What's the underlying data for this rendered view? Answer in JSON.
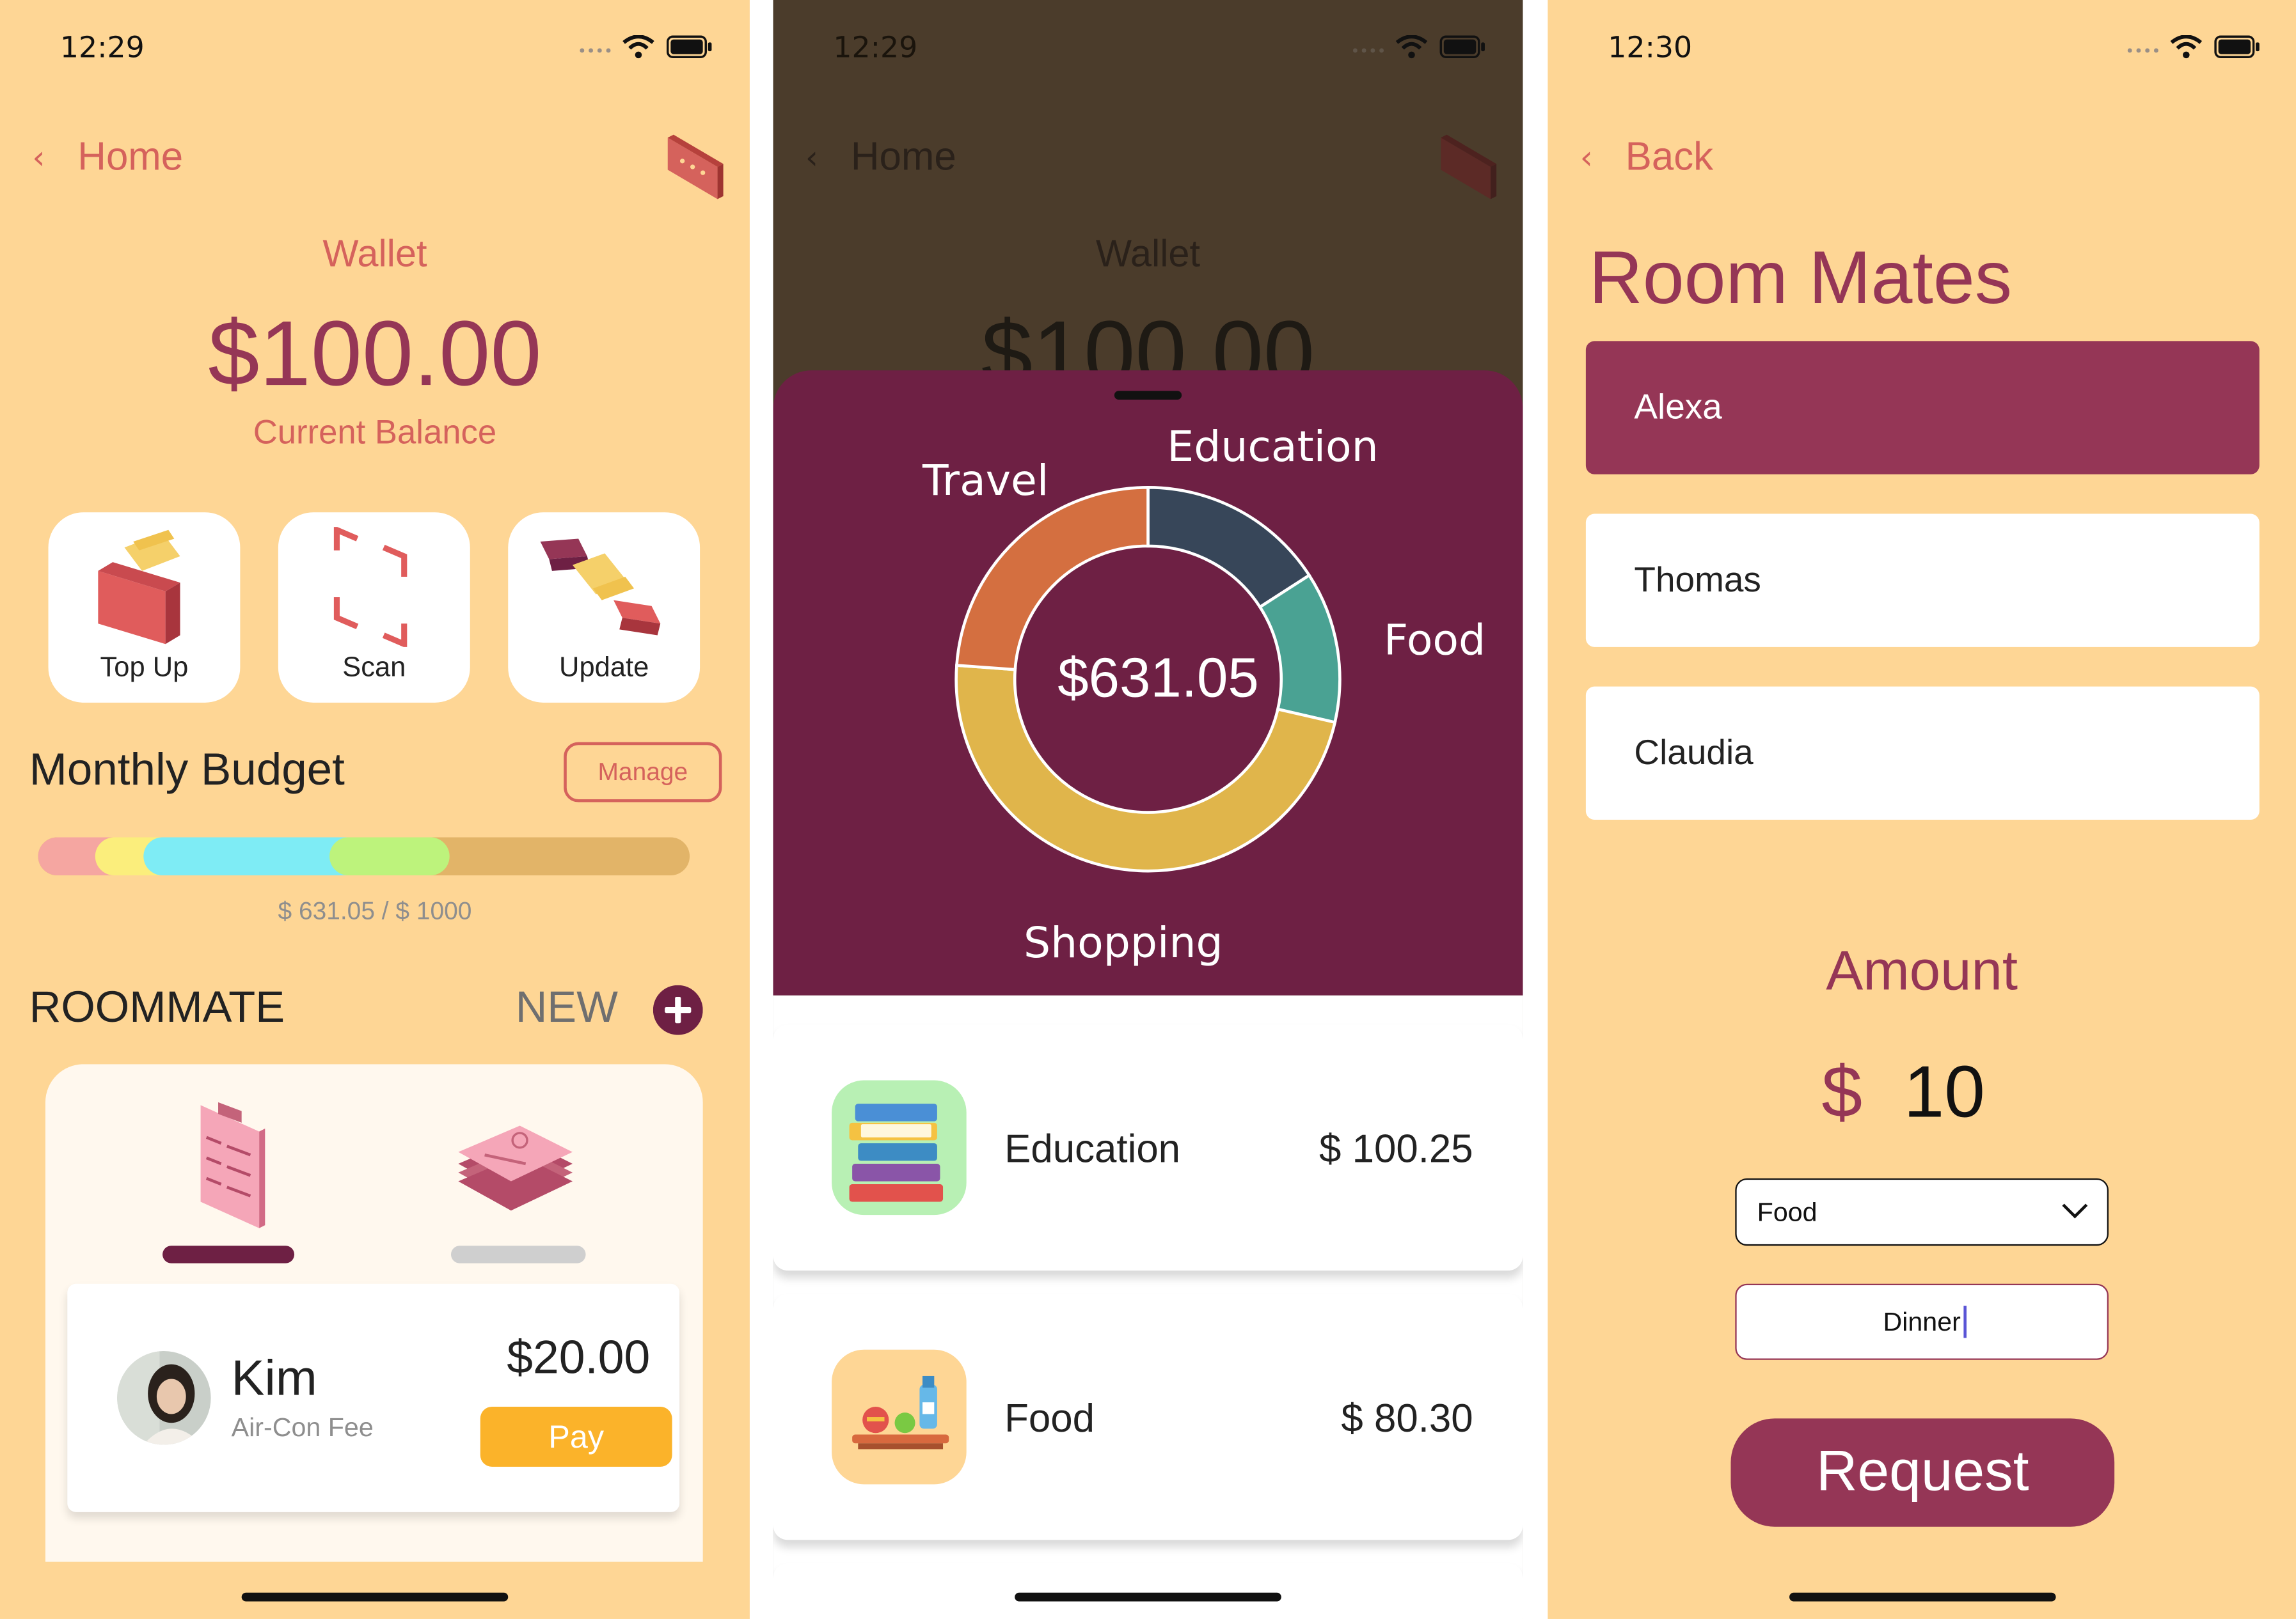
{
  "colors": {
    "background": "#fed695",
    "accent": "#d5625c",
    "plum": "#6e2044",
    "wine": "#953656",
    "pay": "#fbb32a"
  },
  "wallet_screen": {
    "time": "12:29",
    "back_label": "Home",
    "title": "Wallet",
    "balance": "$100.00",
    "balance_caption": "Current Balance",
    "actions": [
      {
        "label": "Top Up",
        "icon": "wallet-icon"
      },
      {
        "label": "Scan",
        "icon": "scan-frame-icon"
      },
      {
        "label": "Update",
        "icon": "transfer-icon"
      }
    ],
    "budget": {
      "title": "Monthly Budget",
      "manage_label": "Manage",
      "spent": 631.05,
      "limit": 1000,
      "caption": "$ 631.05 / $ 1000"
    },
    "roommate": {
      "title": "ROOMMATE",
      "new_label": "NEW",
      "request": {
        "name": "Kim",
        "description": "Air-Con Fee",
        "amount": "$20.00",
        "pay_label": "Pay"
      }
    }
  },
  "spending_screen": {
    "time": "12:29",
    "back_label": "Home",
    "title": "Wallet",
    "balance": "$100.00",
    "total": "$631.05",
    "chart_data": {
      "type": "pie",
      "categories": [
        "Education",
        "Food",
        "Shopping",
        "Travel"
      ],
      "values": [
        100.25,
        80.3,
        300.0,
        150.5
      ],
      "colors": [
        "#374659",
        "#4aa293",
        "#e0b54b",
        "#d46f40"
      ],
      "center_label": "$631.05"
    },
    "categories": [
      {
        "name": "Education",
        "amount": "$ 100.25",
        "icon": "books-icon"
      },
      {
        "name": "Food",
        "amount": "$ 80.30",
        "icon": "food-tray-icon"
      }
    ]
  },
  "request_screen": {
    "time": "12:30",
    "back_label": "Back",
    "title": "Room Mates",
    "mates": [
      {
        "name": "Alexa",
        "selected": true
      },
      {
        "name": "Thomas",
        "selected": false
      },
      {
        "name": "Claudia",
        "selected": false
      }
    ],
    "amount_label": "Amount",
    "currency": "$",
    "amount_value": "10",
    "category_value": "Food",
    "note_value": "Dinner",
    "request_label": "Request"
  }
}
